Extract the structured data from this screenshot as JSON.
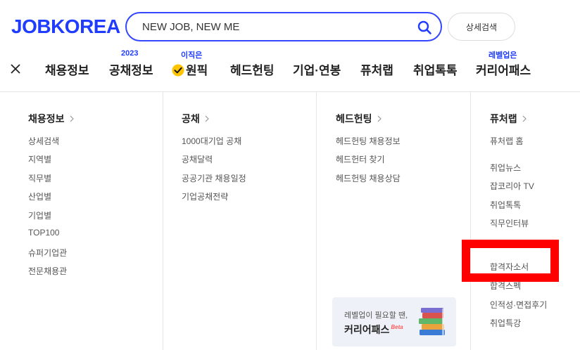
{
  "header": {
    "logo": "JOBKOREA",
    "search": {
      "value": "NEW JOB, NEW ME"
    },
    "detail_search": "상세검색"
  },
  "nav": {
    "items": [
      {
        "label": "채용정보",
        "badge": ""
      },
      {
        "label": "공채정보",
        "badge": "2023"
      },
      {
        "label": "원픽",
        "badge": "이직은"
      },
      {
        "label": "헤드헌팅",
        "badge": ""
      },
      {
        "label": "기업·연봉",
        "badge": ""
      },
      {
        "label": "퓨처랩",
        "badge": ""
      },
      {
        "label": "취업톡톡",
        "badge": ""
      },
      {
        "label": "커리어패스",
        "badge": "레벨업은"
      }
    ]
  },
  "menu": {
    "recruit": {
      "title": "채용정보",
      "links": [
        "상세검색",
        "지역별",
        "직무별",
        "산업별",
        "기업별",
        "TOP100",
        "슈퍼기업관",
        "전문채용관"
      ]
    },
    "gongchae": {
      "title": "공채",
      "links": [
        "1000대기업 공채",
        "공채달력",
        "공공기관 채용일정",
        "기업공채전략"
      ]
    },
    "headhunting": {
      "title": "헤드헌팅",
      "links": [
        "헤드헌팅 채용정보",
        "헤드헌터 찾기",
        "헤드헌팅 채용상담"
      ]
    },
    "futurelab": {
      "title": "퓨처랩",
      "links": [
        "퓨처랩 홈",
        "취업뉴스",
        "잡코리아 TV",
        "취업톡톡",
        "직무인터뷰",
        "합격자소서",
        "합격스펙",
        "인적성·면접후기",
        "취업특강"
      ]
    }
  },
  "promo": {
    "subtitle": "레벨업이 필요할 땐,",
    "title": "커리어패스",
    "beta": "Beta"
  },
  "colors": {
    "brand": "#1f3cff",
    "highlight": "#ff0000"
  }
}
